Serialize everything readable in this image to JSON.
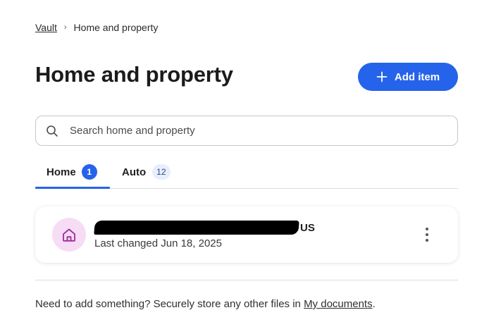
{
  "breadcrumb": {
    "root": "Vault",
    "separator": "›",
    "current": "Home and property"
  },
  "page_title": "Home and property",
  "add_button": {
    "label": "Add item",
    "icon": "plus-icon",
    "color": "#2563eb"
  },
  "search": {
    "placeholder": "Search home and property",
    "value": "",
    "icon": "search-icon"
  },
  "tabs": [
    {
      "label": "Home",
      "count": "1",
      "selected": true
    },
    {
      "label": "Auto",
      "count": "12",
      "selected": false
    }
  ],
  "items": [
    {
      "icon": "home-icon",
      "title_suffix": "US",
      "title_redacted": true,
      "subtitle": "Last changed Jun 18, 2025",
      "menu_icon": "more-vertical-icon"
    }
  ],
  "footer": {
    "text_before": "Need to add something? Securely store any other files in ",
    "link": "My documents",
    "text_after": "."
  },
  "colors": {
    "accent": "#2563eb",
    "avatar_bg": "#f6dcf5",
    "avatar_icon": "#9b2c9b"
  }
}
